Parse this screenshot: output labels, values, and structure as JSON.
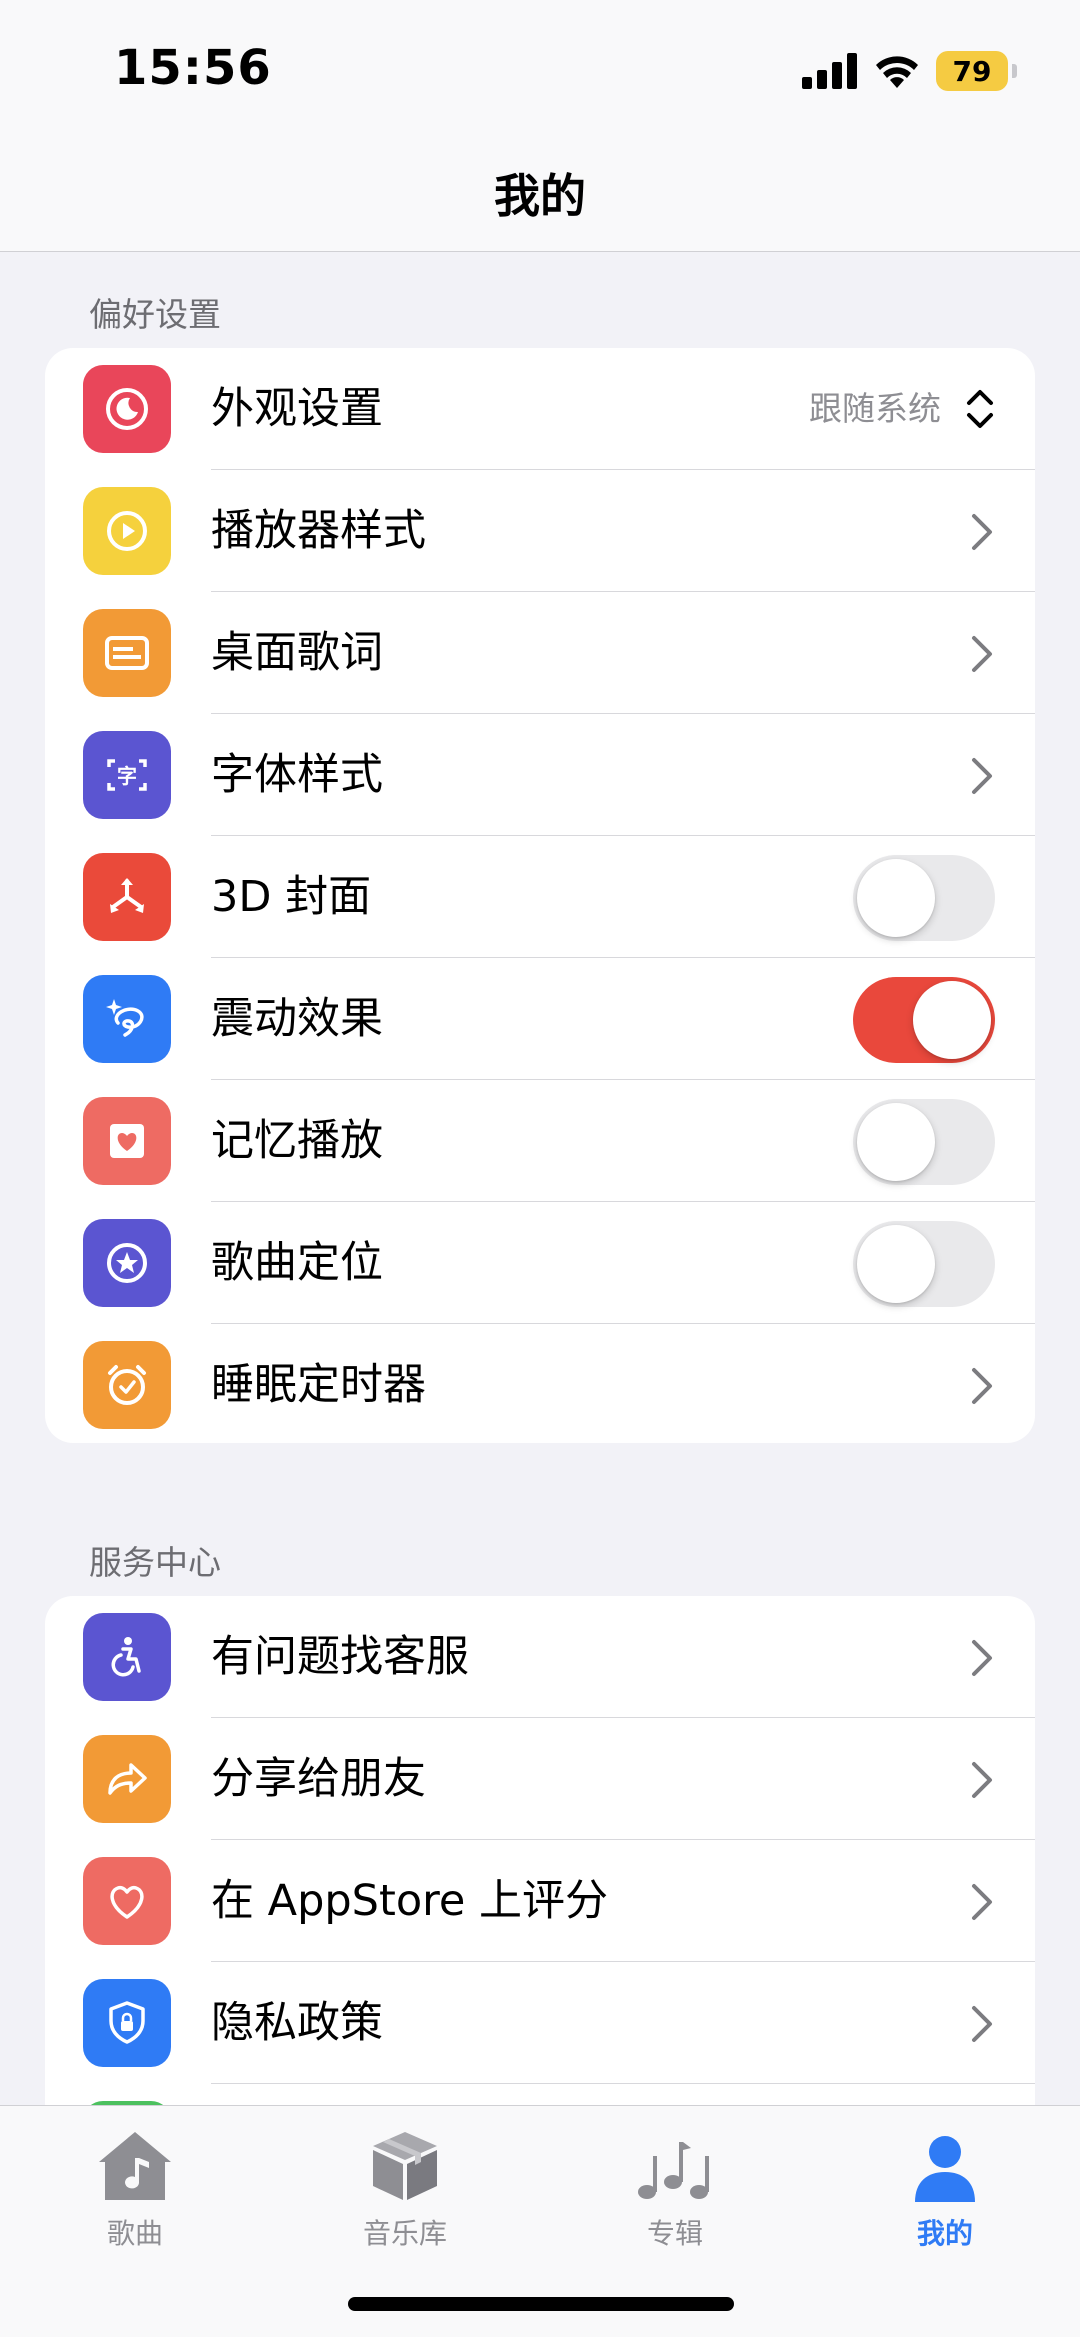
{
  "status": {
    "time": "15:56",
    "battery": "79"
  },
  "nav": {
    "title": "我的"
  },
  "preferences": {
    "header": "偏好设置",
    "appearance": {
      "label": "外观设置",
      "value": "跟随系统",
      "color": "#e9465a"
    },
    "player_style": {
      "label": "播放器样式",
      "color": "#f5d13d"
    },
    "desktop_lyrics": {
      "label": "桌面歌词",
      "color": "#f29a36"
    },
    "font_style": {
      "label": "字体样式",
      "color": "#5b55d1"
    },
    "cover_3d": {
      "label": "3D 封面",
      "on": false,
      "color": "#ea4a3a"
    },
    "haptics": {
      "label": "震动效果",
      "on": true,
      "color": "#2f7bf5"
    },
    "resume_play": {
      "label": "记忆播放",
      "on": false,
      "color": "#ee6b63"
    },
    "locate_song": {
      "label": "歌曲定位",
      "on": false,
      "color": "#5b55d1"
    },
    "sleep_timer": {
      "label": "睡眠定时器",
      "color": "#f29a36"
    }
  },
  "services": {
    "header": "服务中心",
    "support": {
      "label": "有问题找客服",
      "color": "#5b55d1"
    },
    "share": {
      "label": "分享给朋友",
      "color": "#f29a36"
    },
    "rate": {
      "label": "在 AppStore 上评分",
      "color": "#ee6b63"
    },
    "privacy": {
      "label": "隐私政策",
      "color": "#2f7bf5"
    }
  },
  "tabs": [
    {
      "label": "歌曲",
      "icon": "house-music-icon"
    },
    {
      "label": "音乐库",
      "icon": "box-icon"
    },
    {
      "label": "专辑",
      "icon": "music-notes-icon"
    },
    {
      "label": "我的",
      "icon": "person-icon",
      "active": true
    }
  ]
}
